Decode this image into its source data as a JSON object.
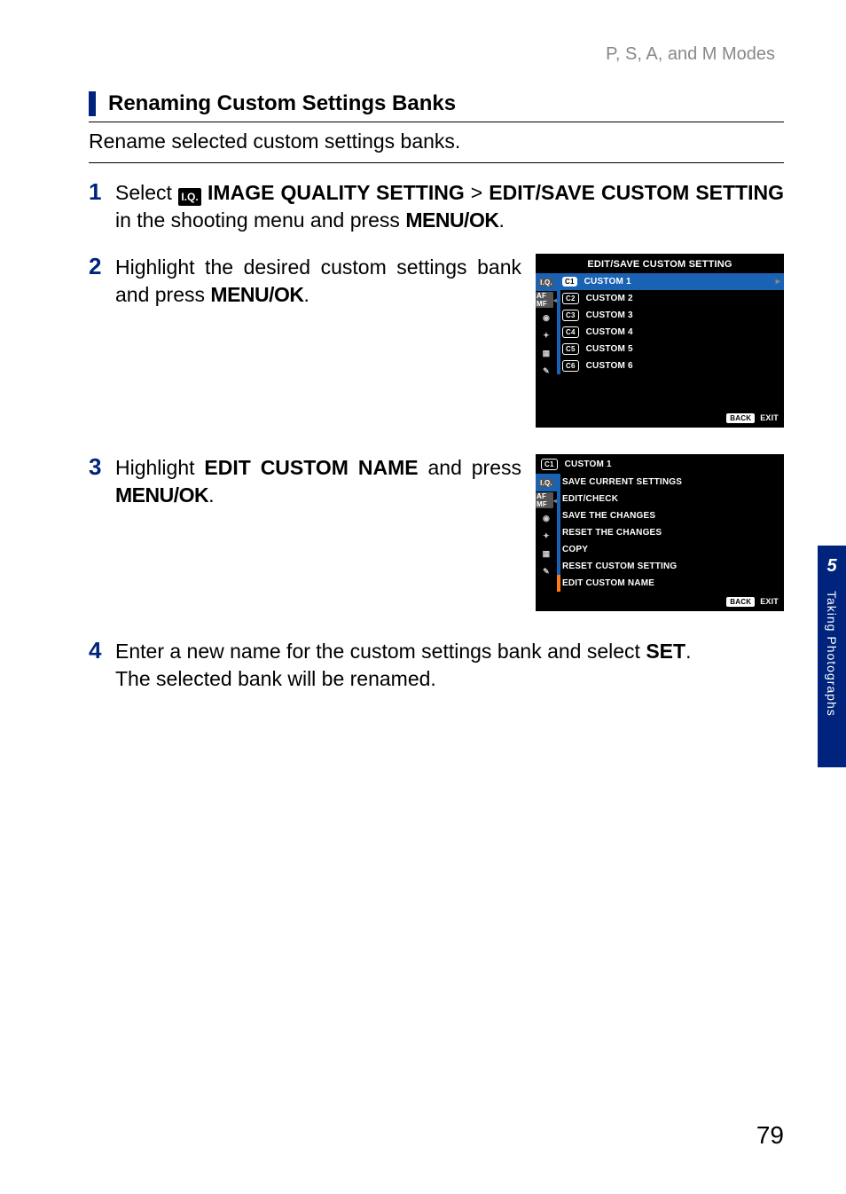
{
  "breadcrumb": "P, S, A, and M Modes",
  "section_title": "Renaming Custom Settings Banks",
  "intro": "Rename selected custom settings banks.",
  "steps": {
    "s1": {
      "num": "1",
      "pre": "Select ",
      "icon": "I.Q.",
      "b1": "IMAGE QUALITY SETTING",
      "gt": " > ",
      "b2": "EDIT/SAVE CUSTOM SETTING",
      "mid": " in the shooting menu and press ",
      "btn": "MENU/OK",
      "end": "."
    },
    "s2": {
      "num": "2",
      "t1": "Highlight the desired custom settings bank and press ",
      "btn": "MENU/OK",
      "end": "."
    },
    "s3": {
      "num": "3",
      "t1": "Highlight ",
      "b1": "EDIT CUSTOM NAME",
      "t2": " and press ",
      "btn": "MENU/OK",
      "end": "."
    },
    "s4": {
      "num": "4",
      "t1": "Enter a new name for the custom settings bank and select ",
      "b1": "SET",
      "end1": ".",
      "t2": "The selected bank will be renamed."
    }
  },
  "screen1": {
    "title": "EDIT/SAVE CUSTOM SETTING",
    "items": [
      {
        "badge": "C1",
        "label": "CUSTOM 1"
      },
      {
        "badge": "C2",
        "label": "CUSTOM 2"
      },
      {
        "badge": "C3",
        "label": "CUSTOM 3"
      },
      {
        "badge": "C4",
        "label": "CUSTOM 4"
      },
      {
        "badge": "C5",
        "label": "CUSTOM 5"
      },
      {
        "badge": "C6",
        "label": "CUSTOM 6"
      }
    ],
    "back": "BACK",
    "exit": "EXIT"
  },
  "screen2": {
    "title_badge": "C1",
    "title": "CUSTOM 1",
    "items": [
      "SAVE CURRENT SETTINGS",
      "EDIT/CHECK",
      "SAVE THE CHANGES",
      "RESET THE CHANGES",
      "COPY",
      "RESET CUSTOM SETTING",
      "EDIT CUSTOM NAME"
    ],
    "back": "BACK",
    "exit": "EXIT"
  },
  "sidebar_glyphs": [
    "I.Q.",
    "AF MF",
    "◉",
    "✦",
    "▦",
    "✎"
  ],
  "side_tab": {
    "chapter": "5",
    "label": "Taking Photographs"
  },
  "page_number": "79"
}
